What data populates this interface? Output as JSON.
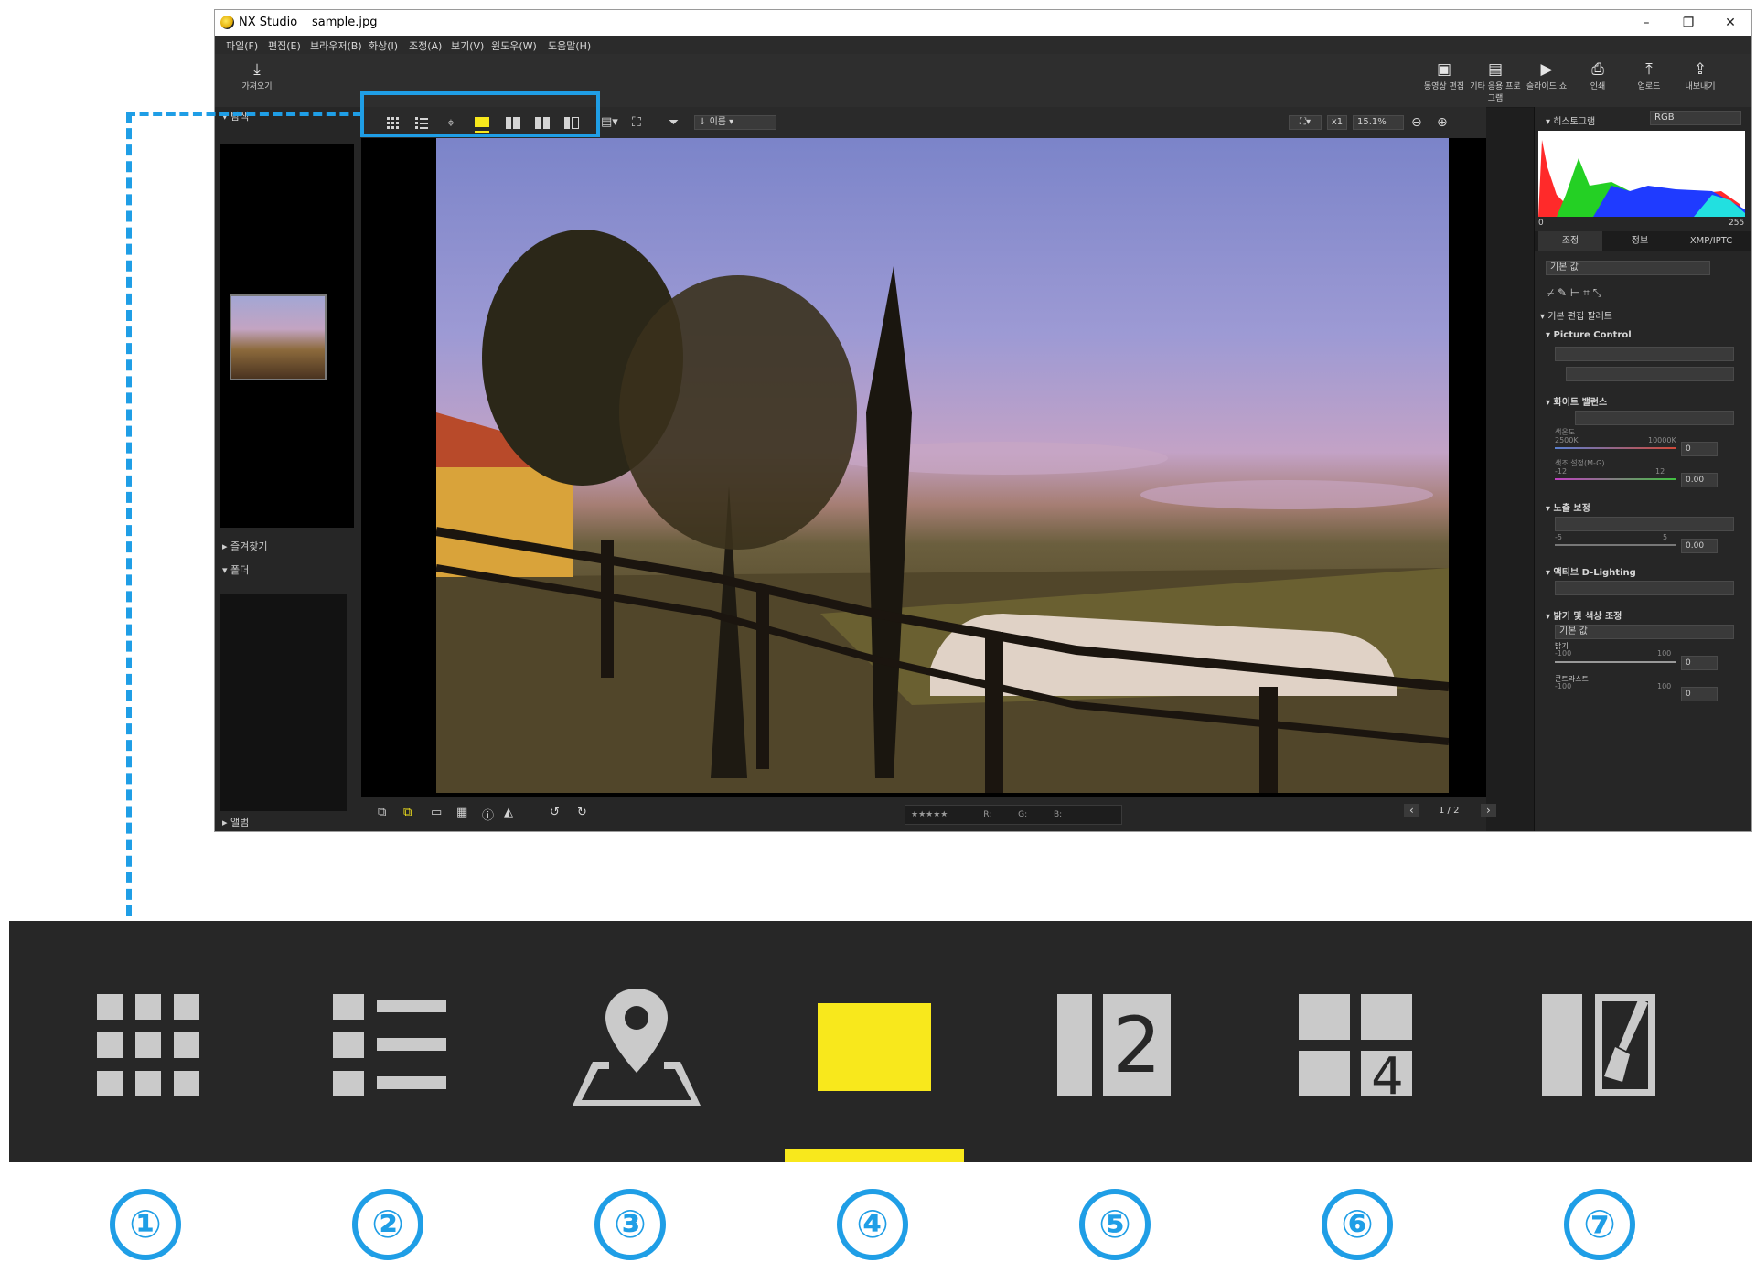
{
  "window": {
    "app_title": "NX Studio",
    "file_name": "sample.jpg",
    "controls": [
      "–",
      "❐",
      "✕"
    ]
  },
  "menu": [
    "파일(F)",
    "편집(E)",
    "브라우저(B)",
    "화상(I)",
    "조정(A)",
    "보기(V)",
    "윈도우(W)",
    "도움말(H)"
  ],
  "toolbar": {
    "import_label": "가져오기",
    "right_items": [
      "동영상 편집",
      "기타 응용 프로그램",
      "슬라이드 쇼",
      "인쇄",
      "업로드",
      "내보내기"
    ]
  },
  "left_panel": {
    "browse_label": "탐색",
    "favorites_label": "즐겨찾기",
    "folder_label": "폴더",
    "album_label": "앨범"
  },
  "view_toolbar": {
    "sort_label": "이름",
    "zoom_x": "x1",
    "zoom_percent": "15.1%"
  },
  "bottom_bar": {
    "rgb_labels": [
      "R:",
      "G:",
      "B:"
    ],
    "page": "1 / 2"
  },
  "right_panel": {
    "histogram_label": "히스토그램",
    "histogram_channel": "RGB",
    "hist_min": "0",
    "hist_max": "255",
    "tabs": [
      "조정",
      "정보",
      "XMP/IPTC"
    ],
    "preset": "기본 값",
    "palette_label": "기본 편집 팔레트",
    "picture_control": "Picture Control",
    "white_balance": "화이트 밸런스",
    "color_temp_label": "색온도",
    "color_temp_min": "2500K",
    "color_temp_max": "10000K",
    "color_temp_value": "0",
    "tint_label": "색조 설정(M-G)",
    "tint_min": "-12",
    "tint_max": "12",
    "tint_value": "0.00",
    "exposure_label": "노출 보정",
    "exposure_min": "-5",
    "exposure_max": "5",
    "exposure_value": "0.00",
    "adl_label": "액티브 D-Lighting",
    "brightness_color_label": "밝기 및 색상 조정",
    "brightness_preset": "기본 값",
    "brightness_label": "밝기",
    "brightness_min": "-100",
    "brightness_max": "100",
    "brightness_value": "0",
    "contrast_label": "콘트라스트",
    "contrast_min": "-100",
    "contrast_max": "100",
    "contrast_value": "0"
  },
  "view_modes": [
    {
      "id": 1,
      "label": "①",
      "icon": "thumbnail-grid-icon"
    },
    {
      "id": 2,
      "label": "②",
      "icon": "list-view-icon"
    },
    {
      "id": 3,
      "label": "③",
      "icon": "map-view-icon"
    },
    {
      "id": 4,
      "label": "④",
      "icon": "single-image-icon",
      "selected": true
    },
    {
      "id": 5,
      "label": "⑤",
      "icon": "compare-2-icon"
    },
    {
      "id": 6,
      "label": "⑥",
      "icon": "compare-4-icon"
    },
    {
      "id": 7,
      "label": "⑦",
      "icon": "before-after-icon"
    }
  ],
  "colors": {
    "accent_blue": "#1f9ee6",
    "selected_yellow": "#f8e81c",
    "icon_gray": "#cacaca",
    "strip_bg": "#272727"
  }
}
